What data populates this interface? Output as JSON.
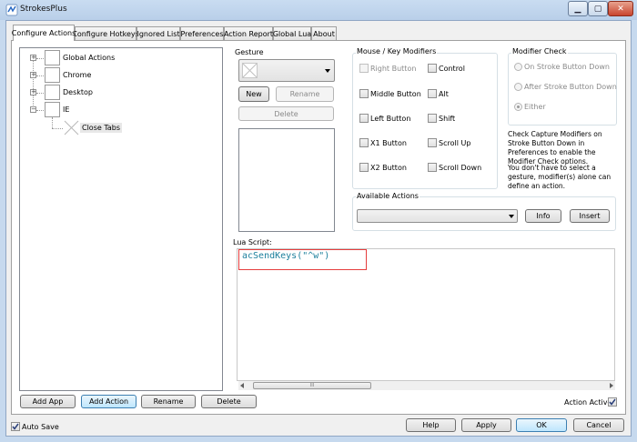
{
  "window": {
    "title": "StrokesPlus"
  },
  "caption_buttons": {
    "minimize": "▁",
    "maximize": "▢",
    "close": "✕"
  },
  "tabs": [
    {
      "label": "Configure Actions",
      "active": true
    },
    {
      "label": "Configure Hotkeys",
      "active": false
    },
    {
      "label": "Ignored List",
      "active": false
    },
    {
      "label": "Preferences",
      "active": false
    },
    {
      "label": "Action Report",
      "active": false
    },
    {
      "label": "Global Lua",
      "active": false
    },
    {
      "label": "About",
      "active": false
    }
  ],
  "tree": {
    "items": [
      {
        "label": "Global Actions"
      },
      {
        "label": "Chrome"
      },
      {
        "label": "Desktop"
      },
      {
        "label": "IE"
      },
      {
        "label": "Close Tabs"
      }
    ]
  },
  "gesture": {
    "label": "Gesture",
    "new_button": "New",
    "rename_button": "Rename",
    "delete_button": "Delete"
  },
  "modifiers": {
    "label": "Mouse / Key Modifiers",
    "items": [
      {
        "label": "Right Button",
        "enabled": false
      },
      {
        "label": "Control",
        "enabled": true
      },
      {
        "label": "Middle Button",
        "enabled": true
      },
      {
        "label": "Alt",
        "enabled": true
      },
      {
        "label": "Left Button",
        "enabled": true
      },
      {
        "label": "Shift",
        "enabled": true
      },
      {
        "label": "X1 Button",
        "enabled": true
      },
      {
        "label": "Scroll Up",
        "enabled": true
      },
      {
        "label": "X2 Button",
        "enabled": true
      },
      {
        "label": "Scroll Down",
        "enabled": true
      }
    ]
  },
  "modifier_check": {
    "label": "Modifier Check",
    "options": [
      {
        "label": "On Stroke Button Down",
        "selected": false
      },
      {
        "label": "After Stroke Button Down",
        "selected": false
      },
      {
        "label": "Either",
        "selected": true
      }
    ],
    "note1": "Check Capture Modifiers on Stroke Button Down in Preferences to enable the Modifier Check options.",
    "note2": "You don't have to select a gesture, modifier(s) alone can define an action."
  },
  "available_actions": {
    "label": "Available Actions",
    "info_button": "Info",
    "insert_button": "Insert"
  },
  "lua_script": {
    "label": "Lua Script:",
    "code": "acSendKeys(\"^w\")"
  },
  "bottom_buttons": {
    "add_app": "Add App",
    "add_action": "Add Action",
    "rename": "Rename",
    "delete": "Delete"
  },
  "action_active": {
    "label": "Action Active",
    "checked": true
  },
  "auto_save": {
    "label": "Auto Save",
    "checked": true
  },
  "dialog_buttons": {
    "help": "Help",
    "apply": "Apply",
    "ok": "OK",
    "cancel": "Cancel"
  },
  "scrollbar": {
    "grip": "III"
  },
  "colors": {
    "script_text": "#1c7f9c",
    "highlight_border": "#e53d3d"
  }
}
